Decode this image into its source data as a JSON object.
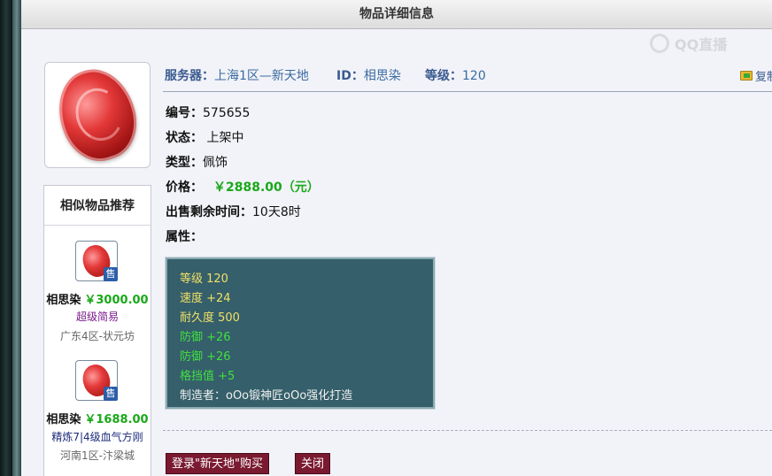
{
  "window": {
    "title": "物品详细信息"
  },
  "watermark": "QQ直播",
  "header": {
    "server_label": "服务器：",
    "server_value": "上海1区—新天地",
    "id_label": "ID：",
    "id_value": "相思染",
    "level_label": "等级：",
    "level_value": "120",
    "copy_label": "复制"
  },
  "details": {
    "number_label": "编号：",
    "number_value": "575655",
    "status_label": "状态：",
    "status_value": "上架中",
    "type_label": "类型：",
    "type_value": "佩饰",
    "price_label": "价格：",
    "price_value": "￥2888.00（元）",
    "time_label": "出售剩余时间：",
    "time_value": "10天8时",
    "attr_label": "属性："
  },
  "attributes": [
    {
      "text": "等级 120",
      "color": "yellow"
    },
    {
      "text": "速度 +24",
      "color": "yellow"
    },
    {
      "text": "耐久度 500",
      "color": "yellow"
    },
    {
      "text": "防御 +26",
      "color": "green"
    },
    {
      "text": "防御 +26",
      "color": "green"
    },
    {
      "text": "格挡值 +5",
      "color": "green"
    },
    {
      "text": "制造者：oOo锻神匠oOo强化打造",
      "color": "white"
    }
  ],
  "similar": {
    "title": "相似物品推荐",
    "badge": "售",
    "items": [
      {
        "name": "相思染",
        "price": "￥3000.00",
        "desc": "超级简易",
        "server": "广东4区-状元坊"
      },
      {
        "name": "相思染",
        "price": "￥1688.00",
        "desc": "精炼7|4级血气方刚",
        "server": "河南1区-汴梁城"
      }
    ]
  },
  "buttons": {
    "login_buy": "登录\"新天地\"购买",
    "close": "关闭"
  },
  "colors": {
    "price_green": "#1aa81a",
    "attr_bg": "#355f6a",
    "attr_yellow": "#f0e068",
    "attr_green": "#40e040",
    "button_bg": "#7a1a30",
    "label_blue": "#3a5a90"
  }
}
